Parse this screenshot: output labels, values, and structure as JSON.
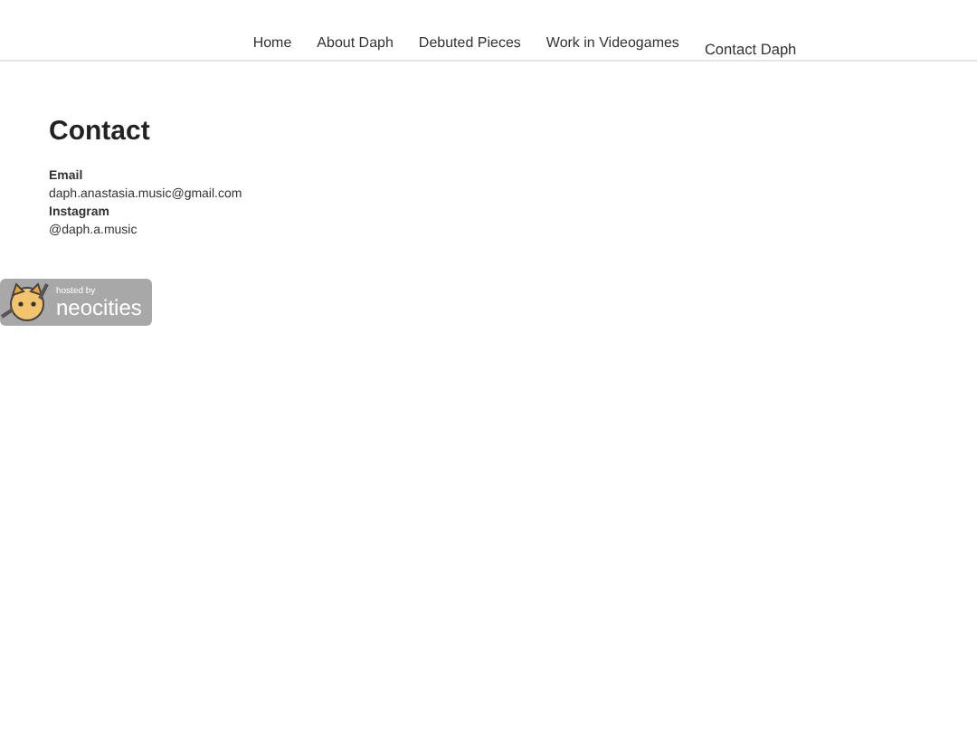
{
  "nav": [
    {
      "label": "Home",
      "selected": false
    },
    {
      "label": "About Daph",
      "selected": false
    },
    {
      "label": "Debuted Pieces",
      "selected": false
    },
    {
      "label": "Work in Videogames",
      "selected": false
    },
    {
      "label": "Contact Daph",
      "selected": true
    }
  ],
  "heading": "Contact",
  "contacts": [
    {
      "label": "Email",
      "value": "daph.anastasia.music@gmail.com"
    },
    {
      "label": "Instagram",
      "value": "@daph.a.music"
    }
  ],
  "badge": {
    "small": "hosted by",
    "big": "neocities"
  }
}
